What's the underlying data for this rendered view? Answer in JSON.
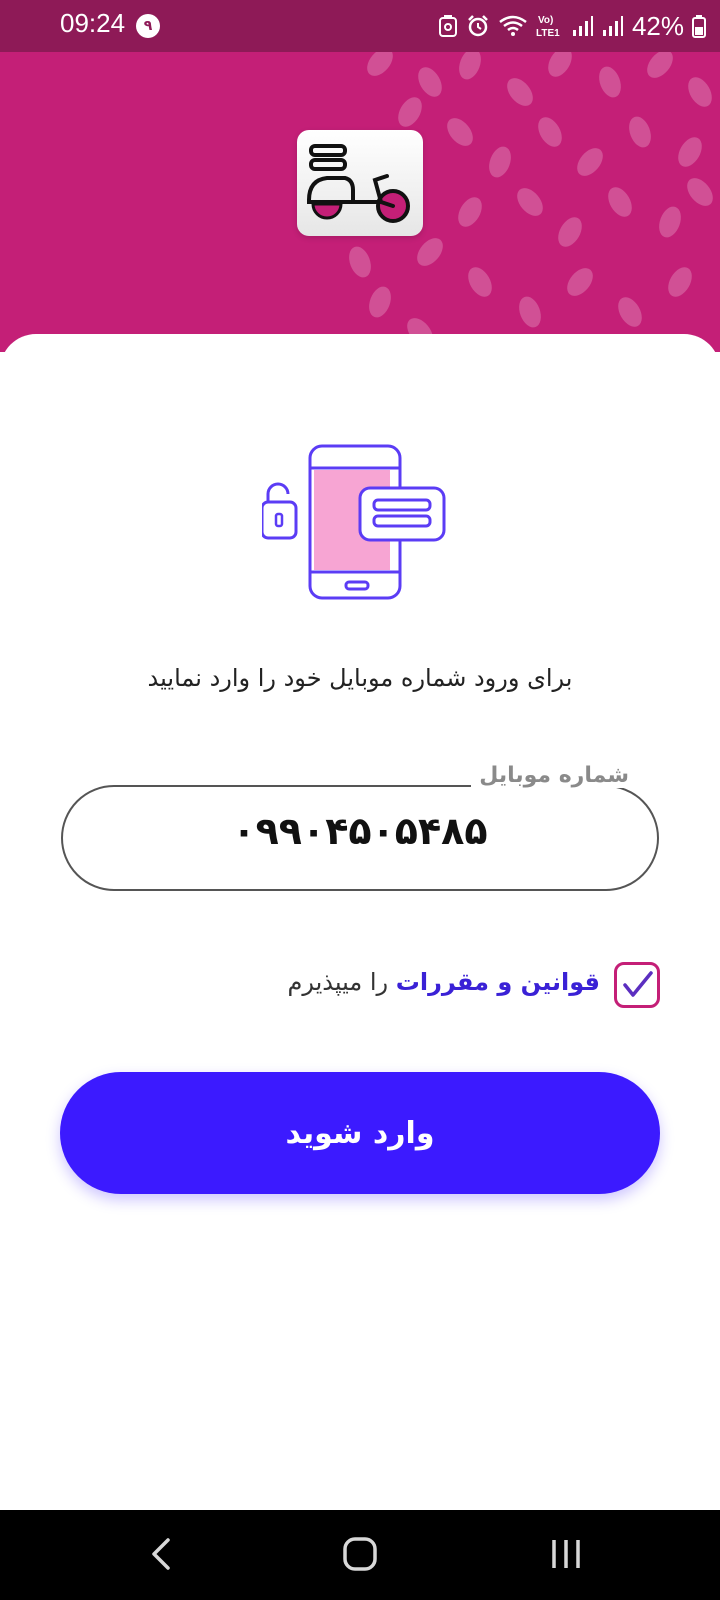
{
  "status_bar": {
    "time": "09:24",
    "notification_badge": "۹",
    "battery_percent": "42%",
    "network_label": "Vo) LTE1",
    "icons": [
      "recycle-icon",
      "alarm-icon",
      "wifi-icon",
      "volte-icon",
      "signal-icon",
      "signal-icon",
      "battery-icon"
    ]
  },
  "header": {
    "background_color": "#c41f77",
    "logo_icon": "delivery-scooter-icon"
  },
  "illustration": {
    "icon": "phone-login-icon"
  },
  "instruction_text": "برای ورود شماره موبایل خود را وارد نمایید",
  "phone_field": {
    "label": "شماره موبایل",
    "value": "۰۹۹۰۴۵۰۵۴۸۵"
  },
  "terms": {
    "checked": true,
    "link_text": "قوانین و مقررات",
    "suffix_text": " را میپذیرم"
  },
  "login_button": {
    "label": "وارد شوید",
    "color": "#3c1aff"
  },
  "nav_bar": {
    "buttons": [
      "back-icon",
      "home-icon",
      "recents-icon"
    ]
  }
}
